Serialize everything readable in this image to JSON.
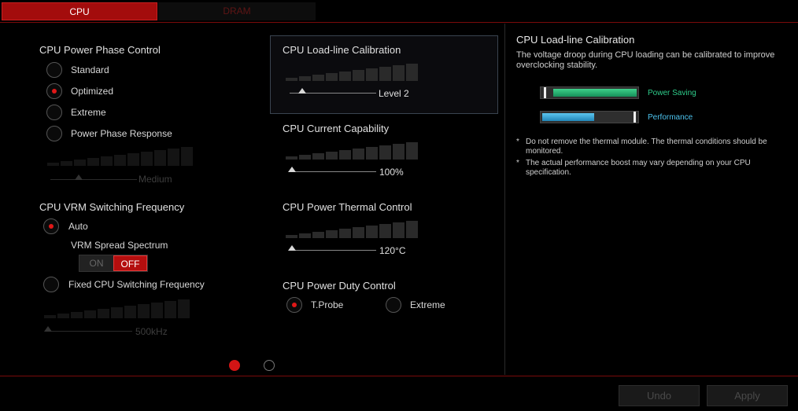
{
  "tabs": [
    {
      "label": "CPU"
    },
    {
      "label": "DRAM"
    }
  ],
  "phase_control": {
    "title": "CPU Power Phase Control",
    "options": [
      {
        "label": "Standard",
        "selected": false
      },
      {
        "label": "Optimized",
        "selected": true
      },
      {
        "label": "Extreme",
        "selected": false
      },
      {
        "label": "Power Phase Response",
        "selected": false
      }
    ],
    "slider_value": "Medium"
  },
  "vrm": {
    "title": "CPU VRM Switching Frequency",
    "auto_label": "Auto",
    "spread_label": "VRM Spread Spectrum",
    "toggle_on": "ON",
    "toggle_off": "OFF",
    "toggle_state": "OFF",
    "fixed_label": "Fixed CPU Switching Frequency",
    "slider_value": "500kHz"
  },
  "llc": {
    "title": "CPU Load-line Calibration",
    "value": "Level 2"
  },
  "current": {
    "title": "CPU Current Capability",
    "value": "100%"
  },
  "thermal": {
    "title": "CPU Power Thermal Control",
    "value": "120°C"
  },
  "duty": {
    "title": "CPU Power Duty Control",
    "options": [
      {
        "label": "T.Probe",
        "selected": true
      },
      {
        "label": "Extreme",
        "selected": false
      }
    ]
  },
  "pager": {
    "pages": 2,
    "current": 1
  },
  "info": {
    "title": "CPU Load-line Calibration",
    "description": "The voltage droop during CPU loading can be calibrated to improve overclocking stability.",
    "bars": [
      {
        "label": "Power Saving",
        "color": "#2ecc8a",
        "level": 0.1
      },
      {
        "label": "Performance",
        "color": "#4dc3ee",
        "level": 0.55
      }
    ],
    "notes": [
      "Do not remove the thermal module. The thermal conditions should be monitored.",
      "The actual performance boost may vary depending on your CPU specification."
    ],
    "note_marker": "*"
  },
  "buttons": {
    "undo": "Undo",
    "apply": "Apply"
  },
  "colors": {
    "accent": "#a30c0c",
    "radio_dot": "#e01818",
    "frame": "#7a0a0a"
  }
}
